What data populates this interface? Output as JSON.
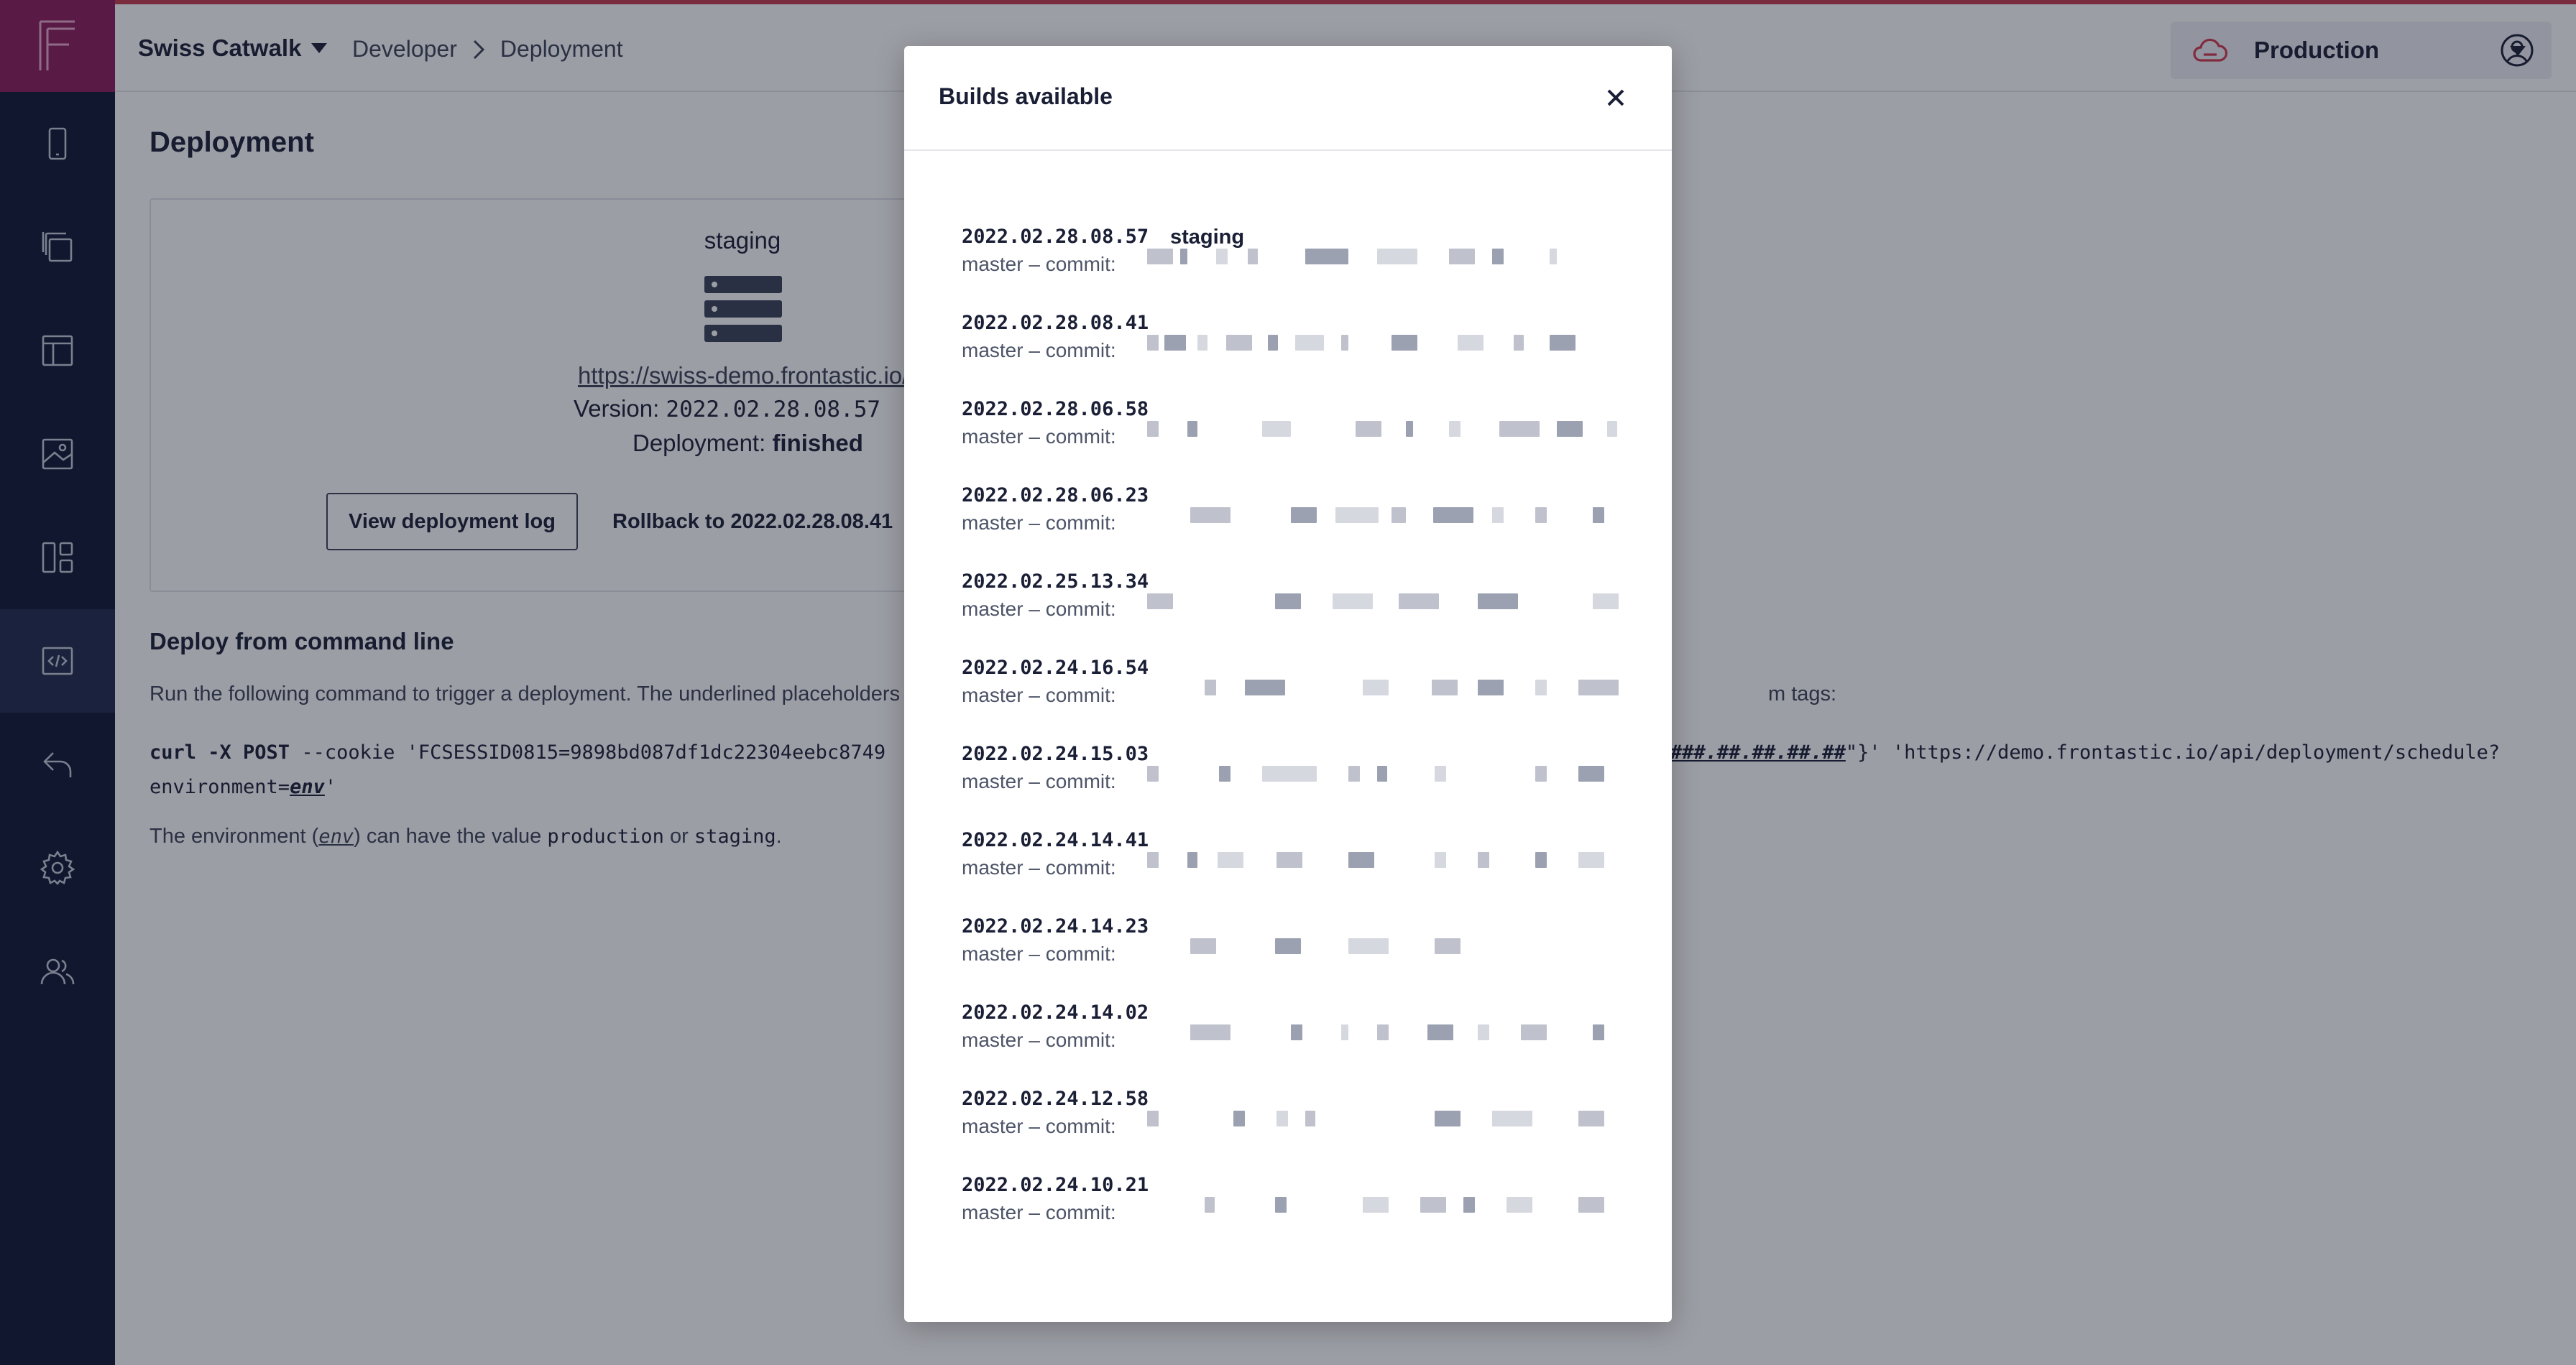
{
  "app": {
    "project_name": "Swiss Catwalk",
    "breadcrumb": [
      "Developer",
      "Deployment"
    ],
    "environment": "Production"
  },
  "sidebar": {
    "items": [
      {
        "icon": "mobile-icon"
      },
      {
        "icon": "copy-icon"
      },
      {
        "icon": "layout-icon"
      },
      {
        "icon": "image-icon"
      },
      {
        "icon": "dashboard-icon"
      },
      {
        "icon": "code-icon",
        "active": true
      },
      {
        "icon": "undo-icon"
      },
      {
        "icon": "gear-icon"
      },
      {
        "icon": "users-icon"
      }
    ]
  },
  "page": {
    "title": "Deployment",
    "card": {
      "environment": "staging",
      "url": "https://swiss-demo.frontastic.io/",
      "version_label": "Version:",
      "version": "2022.02.28.08.57",
      "status_label": "Deployment:",
      "status": "finished",
      "view_log_label": "View deployment log",
      "rollback_label": "Rollback to 2022.02.28.08.41"
    },
    "command_section": {
      "title": "Deploy from command line",
      "description_start": "Run the following command to trigger a deployment. The underlined placeholders ne",
      "description_end": "m tags:",
      "cmd_start_bold": "curl -X POST",
      "cmd_start_rest": " --cookie 'FCSESSID0815=9898bd087df1dc22304eebc8749",
      "cmd_placeholder_version": "###.##.##.##.##",
      "cmd_end": "\"}' 'https://demo.frontastic.io/api/deployment/schedule?",
      "cmd_line2_prefix": "environment=",
      "cmd_line2_placeholder": "env",
      "cmd_line2_suffix": "'",
      "env_note_start": "The environment (",
      "env_note_placeholder": "env",
      "env_note_mid": ") can have the value ",
      "env_note_value1": "production",
      "env_note_or": " or ",
      "env_note_value2": "staging",
      "env_note_end": "."
    }
  },
  "modal": {
    "title": "Builds available",
    "close_icon": "close-icon",
    "builds": [
      {
        "id": "2022.02.28.08.57",
        "tag": "staging",
        "meta": "master – commit:"
      },
      {
        "id": "2022.02.28.08.41",
        "tag": "",
        "meta": "master – commit:"
      },
      {
        "id": "2022.02.28.06.58",
        "tag": "",
        "meta": "master – commit:"
      },
      {
        "id": "2022.02.28.06.23",
        "tag": "",
        "meta": "master – commit:"
      },
      {
        "id": "2022.02.25.13.34",
        "tag": "",
        "meta": "master – commit:"
      },
      {
        "id": "2022.02.24.16.54",
        "tag": "",
        "meta": "master – commit:"
      },
      {
        "id": "2022.02.24.15.03",
        "tag": "",
        "meta": "master – commit:"
      },
      {
        "id": "2022.02.24.14.41",
        "tag": "",
        "meta": "master – commit:"
      },
      {
        "id": "2022.02.24.14.23",
        "tag": "",
        "meta": "master – commit:"
      },
      {
        "id": "2022.02.24.14.02",
        "tag": "",
        "meta": "master – commit:"
      },
      {
        "id": "2022.02.24.12.58",
        "tag": "",
        "meta": "master – commit:"
      },
      {
        "id": "2022.02.24.10.21",
        "tag": "",
        "meta": "master – commit:"
      }
    ]
  },
  "colors": {
    "sidebar_bg": "#0f1734",
    "logo_bg": "#8e1d5c",
    "accent_red": "#c23b4f",
    "text_dark": "#1a1f36"
  }
}
